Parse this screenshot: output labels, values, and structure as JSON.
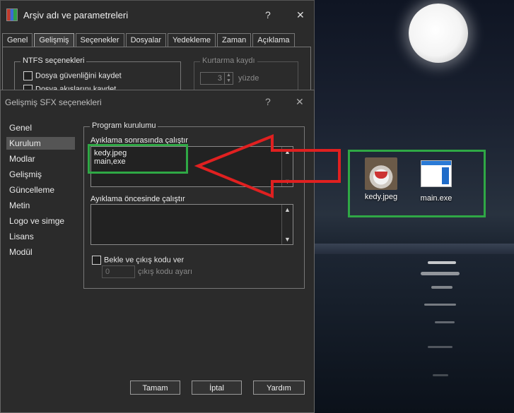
{
  "back_window": {
    "title": "Arşiv adı ve parametreleri",
    "help": "?",
    "close": "✕",
    "tabs": [
      "Genel",
      "Gelişmiş",
      "Seçenekler",
      "Dosyalar",
      "Yedekleme",
      "Zaman",
      "Açıklama"
    ],
    "active_tab": "Gelişmiş",
    "ntfs_group": "NTFS seçenekleri",
    "ntfs_options": [
      "Dosya güvenliğini kaydet",
      "Dosya akışlarını kaydet"
    ],
    "recovery_group": "Kurtarma kaydı",
    "recovery_value": "3",
    "recovery_unit": "yüzde"
  },
  "sfx_dialog": {
    "title": "Gelişmiş SFX seçenekleri",
    "help": "?",
    "close": "✕",
    "nav": [
      "Genel",
      "Kurulum",
      "Modlar",
      "Gelişmiş",
      "Güncelleme",
      "Metin",
      "Logo ve simge",
      "Lisans",
      "Modül"
    ],
    "active_nav": "Kurulum",
    "group_title": "Program kurulumu",
    "after_label": "Ayıklama sonrasında çalıştır",
    "after_value": "kedy.jpeg\nmain,exe",
    "before_label": "Ayıklama öncesinde çalıştır",
    "before_value": "",
    "wait_label": "Bekle ve çıkış kodu ver",
    "exit_code_value": "0",
    "exit_code_label": "çıkış kodu ayarı",
    "buttons": {
      "ok": "Tamam",
      "cancel": "İptal",
      "help": "Yardım"
    }
  },
  "desktop": {
    "icons": [
      {
        "label": "kedy.jpeg",
        "icon": "cat-image-icon"
      },
      {
        "label": "main.exe",
        "icon": "exe-window-icon"
      }
    ]
  },
  "annotation_colors": {
    "highlight": "#2fa845",
    "arrow": "#e02020"
  }
}
